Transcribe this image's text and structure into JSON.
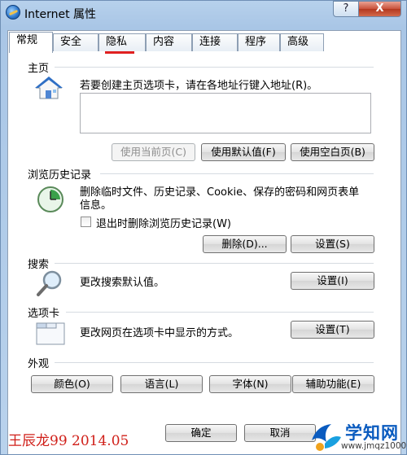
{
  "window": {
    "title": "Internet 属性",
    "help_label": "?",
    "close_label": "X"
  },
  "tabs": [
    {
      "label": "常规",
      "active": true
    },
    {
      "label": "安全"
    },
    {
      "label": "隐私"
    },
    {
      "label": "内容"
    },
    {
      "label": "连接"
    },
    {
      "label": "程序"
    },
    {
      "label": "高级"
    }
  ],
  "home": {
    "title": "主页",
    "description": "若要创建主页选项卡，请在各地址行键入地址(R)。",
    "address_value": "",
    "use_current": "使用当前页(C)",
    "use_default": "使用默认值(F)",
    "use_blank": "使用空白页(B)"
  },
  "history": {
    "title": "浏览历史记录",
    "description_line1": "删除临时文件、历史记录、Cookie、保存的密码和网页表单",
    "description_line2": "信息。",
    "checkbox_label": "退出时删除浏览历史记录(W)",
    "delete_button": "删除(D)...",
    "settings_button": "设置(S)"
  },
  "search": {
    "title": "搜索",
    "description": "更改搜索默认值。",
    "settings_button": "设置(I)"
  },
  "tabs_section": {
    "title": "选项卡",
    "description": "更改网页在选项卡中显示的方式。",
    "settings_button": "设置(T)"
  },
  "appearance": {
    "title": "外观",
    "colors_button": "颜色(O)",
    "languages_button": "语言(L)",
    "fonts_button": "字体(N)",
    "accessibility_button": "辅助功能(E)"
  },
  "footer": {
    "ok_button": "确定",
    "cancel_button": "取消"
  },
  "watermark": "王辰龙99 2014.05",
  "site_logo": {
    "name": "学知网",
    "url": "www.jmqz1000.com"
  },
  "colors": {
    "accent_red": "#d0201a",
    "logo_blue": "#0a5bbf"
  }
}
